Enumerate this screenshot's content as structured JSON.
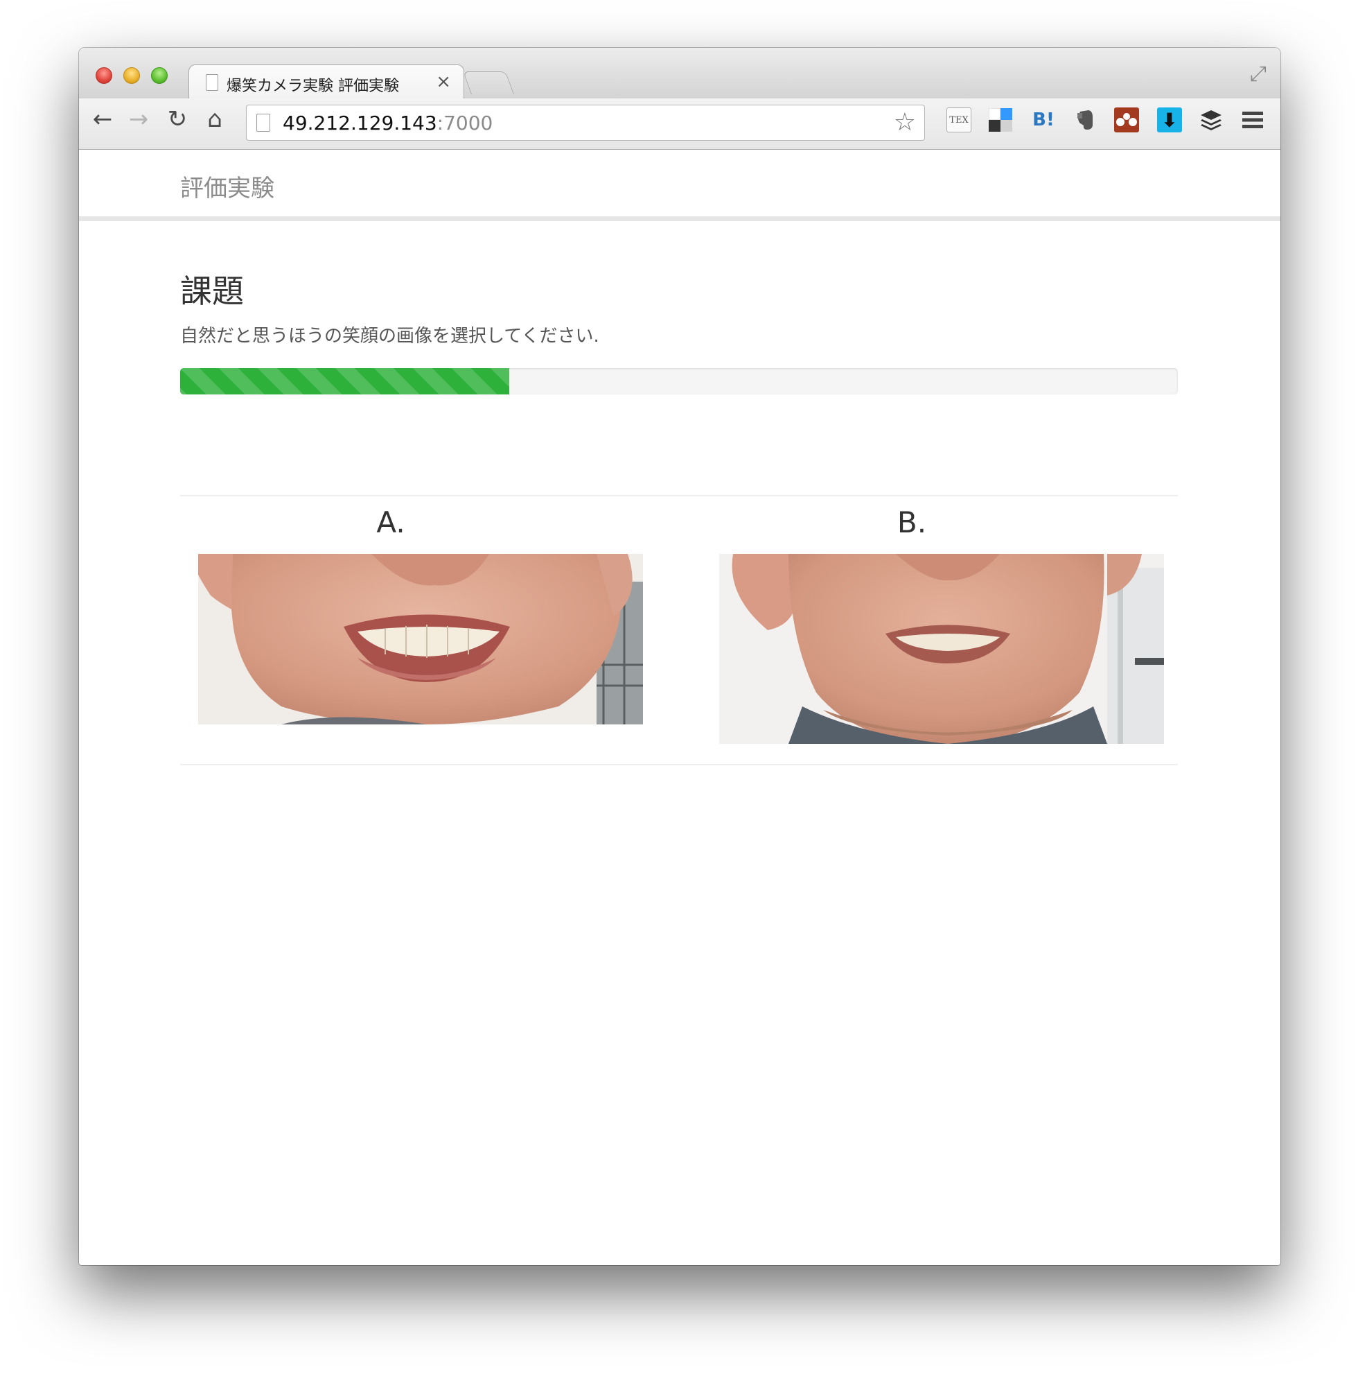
{
  "browser": {
    "tab_title": "爆笑カメラ実験 評価実験",
    "tab_close": "×",
    "url_host": "49.212.129.143",
    "url_port": ":7000",
    "extensions": [
      "tex-icon",
      "delicious-icon",
      "hatena-bookmark-icon",
      "evernote-icon",
      "mendeley-icon",
      "download-icon",
      "buffer-icon",
      "menu-icon"
    ],
    "hatena_label": "B!",
    "tex_label": "TEX"
  },
  "navbar": {
    "brand": "評価実験"
  },
  "task": {
    "heading": "課題",
    "instruction": "自然だと思うほうの笑顔の画像を選択してください.",
    "progress": 0.33,
    "progress_color": "#2eb13a"
  },
  "choices": [
    {
      "label": "A.",
      "image": "smiling-mouth-photo-a"
    },
    {
      "label": "B.",
      "image": "smiling-mouth-photo-b"
    }
  ]
}
